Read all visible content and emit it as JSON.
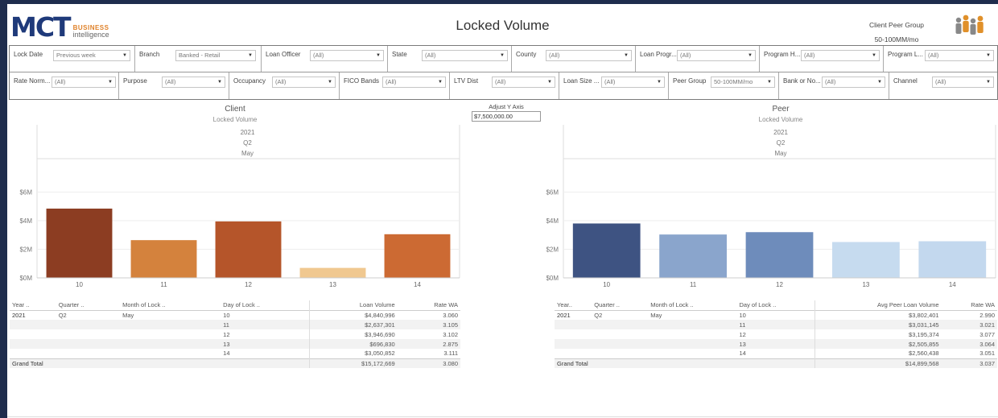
{
  "header": {
    "logo_text": "MCT",
    "logo_business": "BUSINESS",
    "logo_intelligence": "intelligence",
    "title": "Locked Volume",
    "peer_group_label": "Client Peer Group",
    "peer_group_value": "50-100MM/mo",
    "people_icon": "people-group-icon"
  },
  "filters": {
    "lock_date": {
      "label": "Lock Date",
      "value": "Previous week"
    },
    "branch": {
      "label": "Branch",
      "value": "Banked - Retail"
    },
    "loan_officer": {
      "label": "Loan Officer",
      "value": "(All)"
    },
    "state": {
      "label": "State",
      "value": "(All)"
    },
    "county": {
      "label": "County",
      "value": "(All)"
    },
    "loan_program": {
      "label": "Loan Progr...",
      "value": "(All)"
    },
    "program_h": {
      "label": "Program H...",
      "value": "(All)"
    },
    "program_l": {
      "label": "Program L...",
      "value": "(All)"
    },
    "rate_norm": {
      "label": "Rate Norm...",
      "value": "(All)"
    },
    "purpose": {
      "label": "Purpose",
      "value": "(All)"
    },
    "occupancy": {
      "label": "Occupancy",
      "value": "(All)"
    },
    "fico_bands": {
      "label": "FICO Bands",
      "value": "(All)"
    },
    "ltv_dist": {
      "label": "LTV Dist",
      "value": "(All)"
    },
    "loan_size": {
      "label": "Loan Size ...",
      "value": "(All)"
    },
    "peer_group": {
      "label": "Peer Group",
      "value": "50-100MM/mo"
    },
    "bank_or_no": {
      "label": "Bank or No...",
      "value": "(All)"
    },
    "channel": {
      "label": "Channel",
      "value": "(All)"
    }
  },
  "adjust": {
    "label": "Adjust Y Axis",
    "value": "$7,500,000.00"
  },
  "client": {
    "title": "Client",
    "subtitle": "Locked Volume",
    "year": "2021",
    "quarter": "Q2",
    "month": "May",
    "table": {
      "headers": [
        "Year ..",
        "Quarter ..",
        "Month of Lock ..",
        "Day of Lock ..",
        "Loan Volume",
        "Rate WA"
      ],
      "year": "2021",
      "quarter": "Q2",
      "month": "May",
      "rows": [
        {
          "day": "10",
          "volume": "$4,840,996",
          "rate": "3.060"
        },
        {
          "day": "11",
          "volume": "$2,637,301",
          "rate": "3.105"
        },
        {
          "day": "12",
          "volume": "$3,946,690",
          "rate": "3.102"
        },
        {
          "day": "13",
          "volume": "$696,830",
          "rate": "2.875"
        },
        {
          "day": "14",
          "volume": "$3,050,852",
          "rate": "3.111"
        }
      ],
      "total_label": "Grand Total",
      "total_volume": "$15,172,669",
      "total_rate": "3.080"
    }
  },
  "peer": {
    "title": "Peer",
    "subtitle": "Locked Volume",
    "year": "2021",
    "quarter": "Q2",
    "month": "May",
    "table": {
      "headers": [
        "Year..",
        "Quarter ..",
        "Month of Lock ..",
        "Day of Lock ..",
        "Avg Peer Loan Volume",
        "Rate WA"
      ],
      "year": "2021",
      "quarter": "Q2",
      "month": "May",
      "rows": [
        {
          "day": "10",
          "volume": "$3,802,401",
          "rate": "2.990"
        },
        {
          "day": "11",
          "volume": "$3,031,145",
          "rate": "3.021"
        },
        {
          "day": "12",
          "volume": "$3,195,374",
          "rate": "3.077"
        },
        {
          "day": "13",
          "volume": "$2,505,855",
          "rate": "3.064"
        },
        {
          "day": "14",
          "volume": "$2,560,438",
          "rate": "3.051"
        }
      ],
      "total_label": "Grand Total",
      "total_volume": "$14,899,568",
      "total_rate": "3.037"
    }
  },
  "chart_data": [
    {
      "type": "bar",
      "title": "Client",
      "subtitle": "Locked Volume",
      "categories": [
        "10",
        "11",
        "12",
        "13",
        "14"
      ],
      "values": [
        4840996,
        2637301,
        3946690,
        696830,
        3050852
      ],
      "colors": [
        "#8c3d22",
        "#d4823d",
        "#b5552a",
        "#f0c890",
        "#cc6a33"
      ],
      "yticks": [
        "$0M",
        "$2M",
        "$4M",
        "$6M"
      ],
      "ylim": [
        0,
        7500000
      ]
    },
    {
      "type": "bar",
      "title": "Peer",
      "subtitle": "Locked Volume",
      "categories": [
        "10",
        "11",
        "12",
        "13",
        "14"
      ],
      "values": [
        3802401,
        3031145,
        3195374,
        2505855,
        2560438
      ],
      "colors": [
        "#3e5382",
        "#8aa5cc",
        "#6e8cbb",
        "#c6dbef",
        "#c3d8ee"
      ],
      "yticks": [
        "$0M",
        "$2M",
        "$4M",
        "$6M"
      ],
      "ylim": [
        0,
        7500000
      ]
    }
  ]
}
